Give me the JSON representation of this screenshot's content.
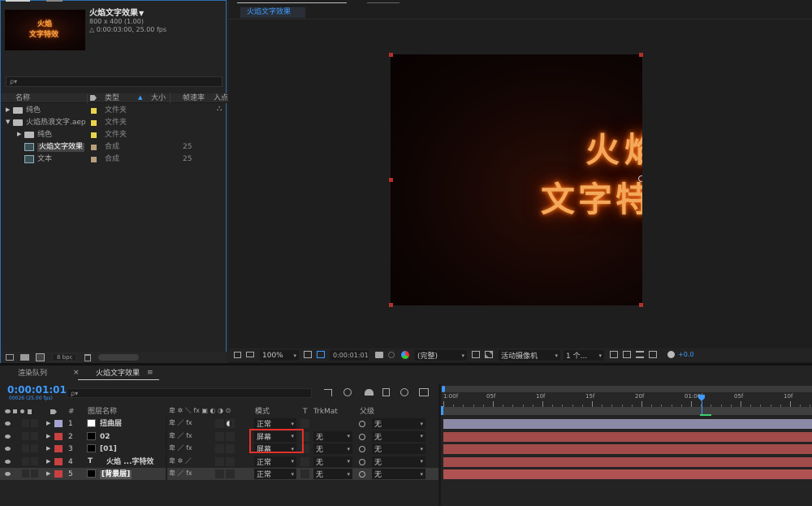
{
  "project": {
    "comp_name": "火焰文字效果",
    "comp_dropdown": "▼",
    "comp_size": "800 x 400 (1.00)",
    "comp_duration": "△ 0:00:03:00, 25.00 fps",
    "thumb_line1": "火焰",
    "thumb_line2": "文字特效",
    "search_placeholder": "ρ▾",
    "columns": {
      "name": "名称",
      "type": "类型",
      "size": "大小",
      "fps": "帧速率",
      "in": "入点"
    },
    "items": [
      {
        "name": "纯色",
        "type": "文件夹",
        "size": "",
        "color": "#e8d44d",
        "kind": "folder",
        "indent": 0,
        "arrow": "▶"
      },
      {
        "name": "火焰热浪文字.aep",
        "type": "文件夹",
        "size": "",
        "color": "#e8d44d",
        "kind": "folder",
        "indent": 0,
        "arrow": "▼"
      },
      {
        "name": "纯色",
        "type": "文件夹",
        "size": "",
        "color": "#e8d44d",
        "kind": "folder",
        "indent": 1,
        "arrow": "▶"
      },
      {
        "name": "火焰文字效果",
        "type": "合成",
        "size": "25",
        "color": "#b8a07c",
        "kind": "comp",
        "indent": 1,
        "arrow": ""
      },
      {
        "name": "文本",
        "type": "合成",
        "size": "25",
        "color": "#b8a07c",
        "kind": "comp",
        "indent": 1,
        "arrow": ""
      }
    ],
    "bpc": "8 bpc"
  },
  "viewer": {
    "tab": "火焰文字效果",
    "fire_line1": "火焰",
    "fire_line2": "文字特效",
    "zoom": "100%",
    "timecode": "0:00:01:01",
    "resolution": "(完整)",
    "camera": "活动摄像机",
    "views": "1 个...",
    "exposure": "+0.0"
  },
  "timeline": {
    "tab_render": "渲染队列",
    "tab_comp": "火焰文字效果",
    "menu": "≡",
    "close": "×",
    "timecode": "0:00:01:01",
    "frame_info": "00026 (25.00 fps)",
    "search_placeholder": "ρ▾",
    "headers": {
      "num": "#",
      "layer_name": "图层名称",
      "mode": "模式",
      "t": "T",
      "trkmat": "TrkMat",
      "parent": "父级"
    },
    "ruler_labels": [
      "1:00f",
      "05f",
      "10f",
      "15f",
      "20f",
      "01:00f",
      "05f",
      "10f"
    ],
    "layers": [
      {
        "num": "1",
        "name": "扭曲层",
        "color": "#a5a3cf",
        "type": "solid-white",
        "mode": "正常",
        "trkmat": "",
        "parent": "无",
        "bar": "#8b8aa6"
      },
      {
        "num": "2",
        "name": "02",
        "color": "#c94141",
        "type": "solid-black",
        "mode": "屏幕",
        "trkmat": "无",
        "parent": "无",
        "bar": "#a14b4b"
      },
      {
        "num": "3",
        "name": "[01]",
        "color": "#c94141",
        "type": "solid-black",
        "mode": "屏幕",
        "trkmat": "无",
        "parent": "无",
        "bar": "#a14b4b"
      },
      {
        "num": "4",
        "name": "火焰 ...字特效",
        "color": "#c94141",
        "type": "text",
        "mode": "正常",
        "trkmat": "无",
        "parent": "无",
        "bar": "#a14b4b"
      },
      {
        "num": "5",
        "name": "[背景层]",
        "color": "#c94141",
        "type": "solid-black",
        "mode": "正常",
        "trkmat": "无",
        "parent": "无",
        "bar": "#b05252"
      }
    ],
    "text_layer_icon": "T"
  }
}
